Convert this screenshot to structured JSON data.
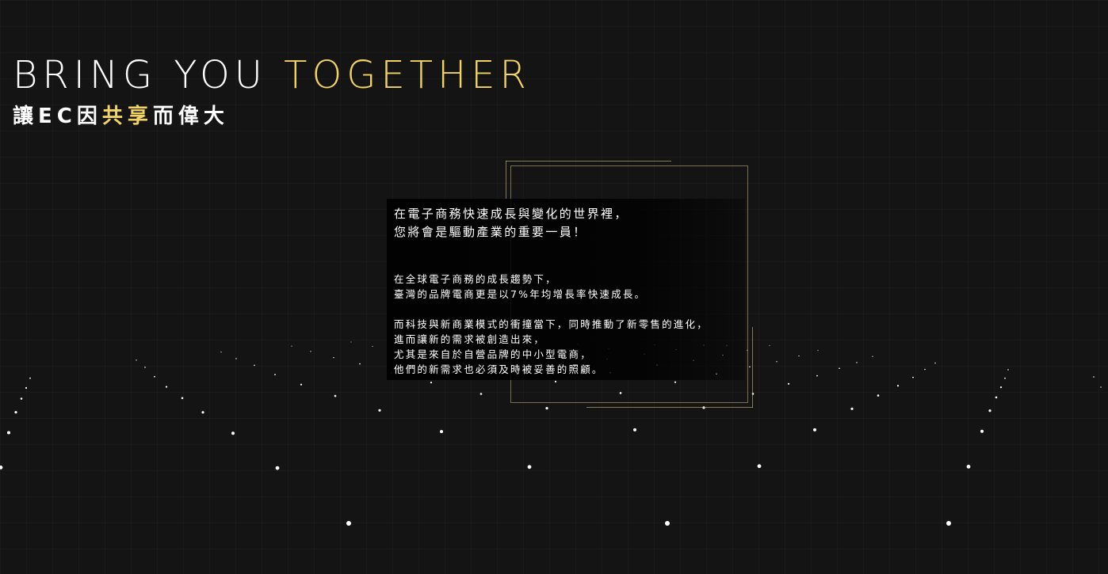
{
  "hero": {
    "title_prefix": "BRING YOU ",
    "title_accent": "TOGETHER",
    "subtitle_prefix": "讓EC因",
    "subtitle_accent": "共享",
    "subtitle_suffix": "而偉大"
  },
  "intro": {
    "lead_lines": [
      "在電子商務快速成長與變化的世界裡，",
      "您將會是驅動產業的重要一員！"
    ],
    "paragraph1_lines": [
      "在全球電子商務的成長趨勢下，",
      "臺灣的品牌電商更是以7%年均增長率快速成長。"
    ],
    "paragraph2_lines": [
      "而科技與新商業模式的衝撞當下，同時推動了新零售的進化，",
      "進而讓新的需求被創造出來，",
      "尤其是來自於自營品牌的中小型電商，",
      "他們的新需求也必須及時被妥善的照顧。"
    ]
  },
  "colors": {
    "background": "#141414",
    "accent": "#f2d463",
    "text": "#ffffff",
    "frame": "#c8be82"
  }
}
